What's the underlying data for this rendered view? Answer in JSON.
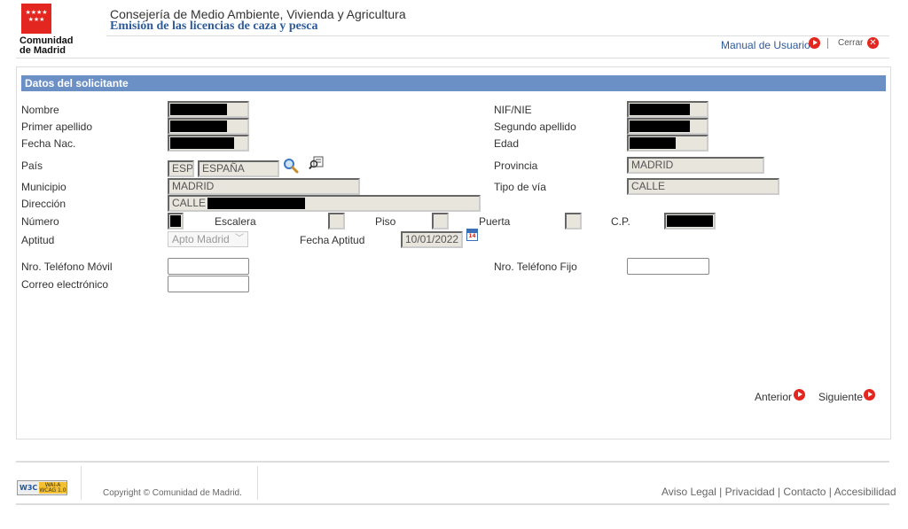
{
  "header": {
    "org_line1": "Comunidad",
    "org_line2": "de Madrid",
    "department": "Consejería de Medio Ambiente, Vivienda y Agricultura",
    "title": "Emisión de las licencias de caza y pesca",
    "manual_link": "Manual de Usuario",
    "close_link": "Cerrar"
  },
  "section": {
    "title": "Datos del solicitante"
  },
  "form": {
    "nombre_label": "Nombre",
    "primer_apellido_label": "Primer apellido",
    "fecha_nac_label": "Fecha Nac.",
    "pais_label": "País",
    "pais_code": "ESP",
    "pais_name": "ESPAÑA",
    "municipio_label": "Municipio",
    "municipio_value": "MADRID",
    "direccion_label": "Dirección",
    "direccion_value": "CALLE",
    "numero_label": "Número",
    "escalera_label": "Escalera",
    "piso_label": "Piso",
    "puerta_label": "Puerta",
    "cp_label": "C.P.",
    "aptitud_label": "Aptitud",
    "aptitud_value": "Apto Madrid",
    "fecha_aptitud_label": "Fecha Aptitud",
    "fecha_aptitud_value": "10/01/2022",
    "nif_label": "NIF/NIE",
    "segundo_apellido_label": "Segundo apellido",
    "edad_label": "Edad",
    "provincia_label": "Provincia",
    "provincia_value": "MADRID",
    "tipo_via_label": "Tipo de vía",
    "tipo_via_value": "CALLE",
    "movil_label": "Nro. Teléfono Móvil",
    "fijo_label": "Nro. Teléfono Fijo",
    "email_label": "Correo electrónico"
  },
  "nav": {
    "previous": "Anterior",
    "next": "Siguiente"
  },
  "footer": {
    "badge_w3c": "W3C",
    "badge_text_1": "WAI-A",
    "badge_text_2": "WCAG 1.0",
    "copyright": "Copyright © Comunidad de Madrid.",
    "links": "Aviso Legal | Privacidad | Contacto | Accesibilidad"
  },
  "icons": {
    "calendar_day": "14"
  },
  "colors": {
    "section_bar": "#6b90c5",
    "brand_red": "#e3261f",
    "title_blue": "#2e5b9a"
  }
}
